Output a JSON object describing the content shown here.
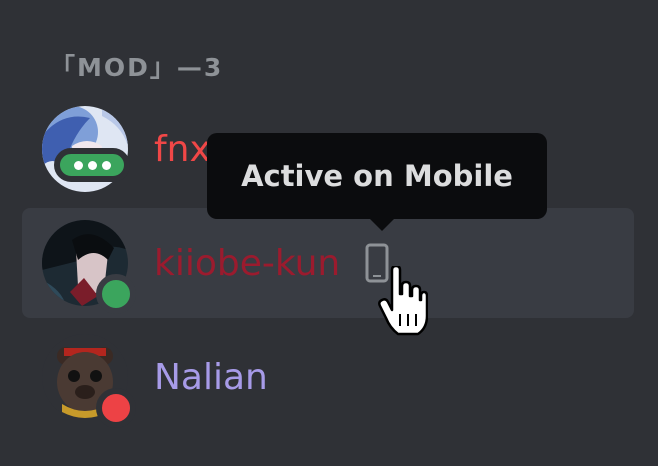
{
  "member_list": {
    "group_header": "「MOD」—3",
    "members": [
      {
        "name": "fnx",
        "name_color": "#f04747",
        "status": "online",
        "status_color": "#3ba55d",
        "avatar_icon": "anime-avatar-blue"
      },
      {
        "name": "kiiobe-kun",
        "name_color": "#9b1b2e",
        "status": "online",
        "status_color": "#3ba55d",
        "device_icon": "mobile-phone-icon",
        "avatar_icon": "anime-avatar-dark"
      },
      {
        "name": "Nalian",
        "name_color": "#a79be8",
        "status": "do-not-disturb",
        "status_color": "#ed4245",
        "avatar_icon": "bear-avatar"
      }
    ]
  },
  "tooltip": {
    "text": "Active on Mobile"
  },
  "colors": {
    "background": "#2f3136",
    "hover_background": "#393c43",
    "tooltip_background": "#0b0c0e",
    "header_text": "#8e9297"
  },
  "cursor_icon": "hand-pointer-icon"
}
